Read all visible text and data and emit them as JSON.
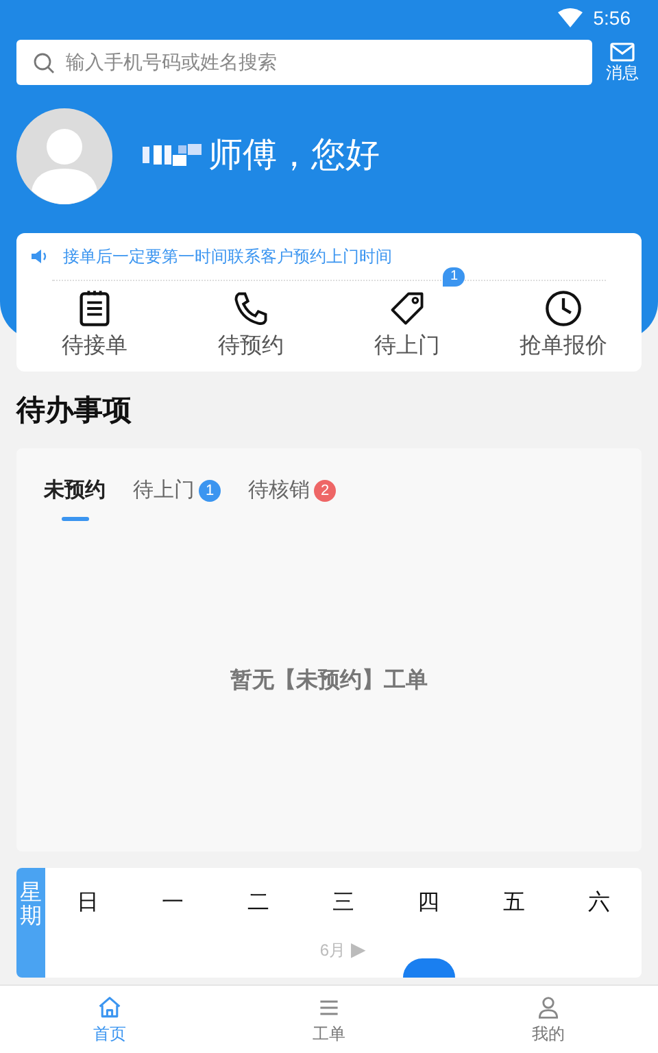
{
  "status_bar": {
    "time": "5:56"
  },
  "search": {
    "placeholder": "输入手机号码或姓名搜索"
  },
  "messages": {
    "label": "消息"
  },
  "greeting": {
    "text": "师傅，您好"
  },
  "notice": {
    "text": "接单后一定要第一时间联系客户预约上门时间"
  },
  "shortcuts": [
    {
      "kind": "list",
      "label": "待接单"
    },
    {
      "kind": "phone",
      "label": "待预约"
    },
    {
      "kind": "tag",
      "label": "待上门",
      "badge": "1"
    },
    {
      "kind": "clock",
      "label": "抢单报价"
    }
  ],
  "todo": {
    "title": "待办事项",
    "tabs": [
      {
        "label": "未预约",
        "selected": true
      },
      {
        "label": "待上门",
        "selected": false,
        "badge": "1",
        "color": "#3b95f0"
      },
      {
        "label": "待核销",
        "selected": false,
        "badge": "2",
        "color": "#ee6666"
      }
    ],
    "empty_text": "暂无【未预约】工单"
  },
  "calendar": {
    "week_label": "星期",
    "weekdays": [
      "日",
      "一",
      "二",
      "三",
      "四",
      "五",
      "六"
    ],
    "month": "6月",
    "arrow": "▶"
  },
  "bottom_nav": [
    {
      "kind": "home",
      "label": "首页",
      "selected": true
    },
    {
      "kind": "list",
      "label": "工单",
      "selected": false
    },
    {
      "kind": "user",
      "label": "我的",
      "selected": false
    }
  ]
}
